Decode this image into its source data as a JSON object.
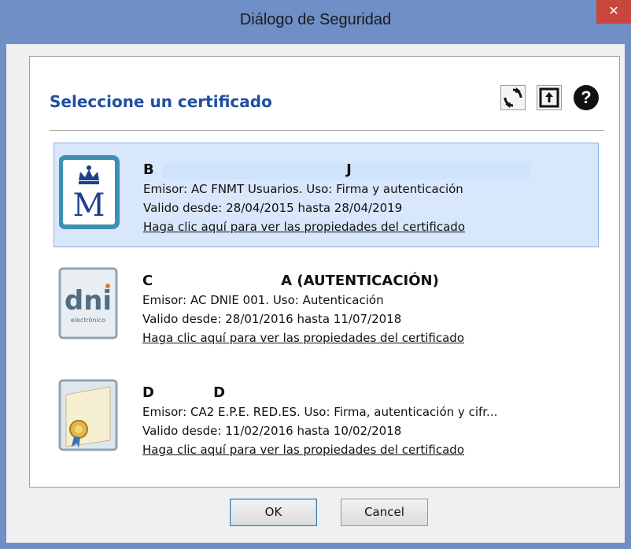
{
  "window": {
    "title": "Diálogo de Seguridad",
    "close_glyph": "✕"
  },
  "dialog": {
    "heading": "Seleccione un certificado",
    "toolbar": {
      "refresh_icon": "refresh-icon",
      "export_icon": "export-icon",
      "help_icon": "help-icon",
      "help_glyph": "?"
    },
    "certificates": [
      {
        "name": "B                                       J",
        "issuer": "Emisor: AC FNMT Usuarios. Uso: Firma y autenticación",
        "validity": "Valido desde: 28/04/2015 hasta 28/04/2019",
        "link": "Haga clic aquí para ver las propiedades del certificado",
        "icon": "fnmt-crown-m-icon",
        "selected": true
      },
      {
        "name": "C                          A (AUTENTICACIÓN)",
        "issuer": "Emisor: AC DNIE 001. Uso: Autenticación",
        "validity": "Valido desde: 28/01/2016 hasta 11/07/2018",
        "link": "Haga clic aquí para ver las propiedades del certificado",
        "icon": "dni-electronico-icon",
        "icon_text": "dni",
        "icon_subtext": "electrónico",
        "selected": false
      },
      {
        "name": "D            D",
        "issuer": "Emisor: CA2 E.P.E. RED.ES. Uso: Firma, autenticación y cifr...",
        "validity": "Valido desde: 11/02/2016 hasta 10/02/2018",
        "link": "Haga clic aquí para ver las propiedades del certificado",
        "icon": "certificate-seal-icon",
        "selected": false
      }
    ],
    "buttons": {
      "ok": "OK",
      "cancel": "Cancel"
    }
  },
  "colors": {
    "title_bar": "#6f8fc6",
    "heading": "#1f4f9f",
    "selection": "#d8e7fb",
    "close": "#c9463d"
  }
}
